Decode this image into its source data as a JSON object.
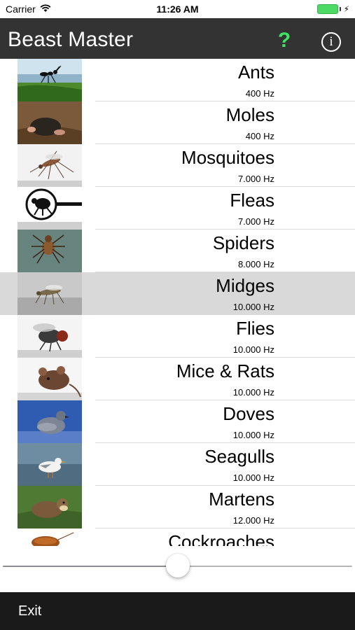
{
  "status_bar": {
    "carrier": "Carrier",
    "time": "11:26 AM",
    "battery_color": "#4cd964"
  },
  "nav": {
    "title": "Beast Master",
    "help_label": "?",
    "help_color": "#3ee565",
    "info_label": "i"
  },
  "animals": [
    {
      "name": "Ants",
      "frequency": "400 Hz",
      "image": "ant-photo"
    },
    {
      "name": "Moles",
      "frequency": "400 Hz",
      "image": "mole-photo"
    },
    {
      "name": "Mosquitoes",
      "frequency": "7.000 Hz",
      "image": "mosquito-photo"
    },
    {
      "name": "Fleas",
      "frequency": "7.000 Hz",
      "image": "flea-icon"
    },
    {
      "name": "Spiders",
      "frequency": "8.000 Hz",
      "image": "spider-photo"
    },
    {
      "name": "Midges",
      "frequency": "10.000 Hz",
      "image": "midge-photo",
      "selected": true
    },
    {
      "name": "Flies",
      "frequency": "10.000 Hz",
      "image": "fly-photo"
    },
    {
      "name": "Mice & Rats",
      "frequency": "10.000 Hz",
      "image": "mouse-photo"
    },
    {
      "name": "Doves",
      "frequency": "10.000 Hz",
      "image": "dove-photo"
    },
    {
      "name": "Seagulls",
      "frequency": "10.000 Hz",
      "image": "seagull-photo"
    },
    {
      "name": "Martens",
      "frequency": "12.000 Hz",
      "image": "marten-photo"
    },
    {
      "name": "Cockroaches",
      "frequency": "",
      "image": "cockroach-photo"
    }
  ],
  "slider": {
    "value": 0.5
  },
  "bottom_bar": {
    "exit_label": "Exit"
  }
}
